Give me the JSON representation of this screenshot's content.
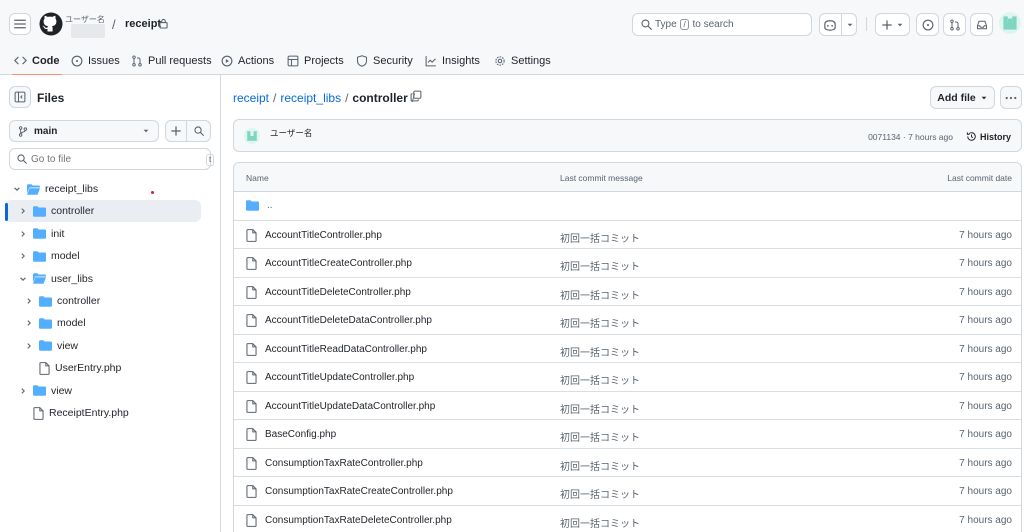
{
  "header": {
    "owner_label": "ユーザー名",
    "repo_name": "receipt",
    "search_prefix": "Type",
    "search_key": "/",
    "search_suffix": "to search"
  },
  "tabs": [
    {
      "label": "Code",
      "icon": "code-icon",
      "active": true
    },
    {
      "label": "Issues",
      "icon": "issue-icon"
    },
    {
      "label": "Pull requests",
      "icon": "pull-request-icon"
    },
    {
      "label": "Actions",
      "icon": "play-icon"
    },
    {
      "label": "Projects",
      "icon": "table-icon"
    },
    {
      "label": "Security",
      "icon": "shield-icon"
    },
    {
      "label": "Insights",
      "icon": "graph-icon"
    },
    {
      "label": "Settings",
      "icon": "gear-icon"
    }
  ],
  "sidebar": {
    "title": "Files",
    "branch": "main",
    "goto_placeholder": "Go to file",
    "goto_key": "t",
    "tree": [
      {
        "label": "receipt_libs",
        "type": "folder",
        "depth": 0,
        "expanded": true
      },
      {
        "label": "controller",
        "type": "folder",
        "depth": 1,
        "expanded": false,
        "selected": true
      },
      {
        "label": "init",
        "type": "folder",
        "depth": 1,
        "expanded": false
      },
      {
        "label": "model",
        "type": "folder",
        "depth": 1,
        "expanded": false
      },
      {
        "label": "user_libs",
        "type": "folder",
        "depth": 1,
        "expanded": true
      },
      {
        "label": "controller",
        "type": "folder",
        "depth": 2,
        "expanded": false
      },
      {
        "label": "model",
        "type": "folder",
        "depth": 2,
        "expanded": false
      },
      {
        "label": "view",
        "type": "folder",
        "depth": 2,
        "expanded": false
      },
      {
        "label": "UserEntry.php",
        "type": "file",
        "depth": 2
      },
      {
        "label": "view",
        "type": "folder",
        "depth": 1,
        "expanded": false
      },
      {
        "label": "ReceiptEntry.php",
        "type": "file",
        "depth": 1
      }
    ]
  },
  "main": {
    "breadcrumb": {
      "root": "receipt",
      "mid": "receipt_libs",
      "current": "controller"
    },
    "add_file_label": "Add file",
    "commit": {
      "user": "ユーザー名",
      "meta": "0071134 · 7 hours ago",
      "history_label": "History"
    },
    "columns": {
      "name": "Name",
      "message": "Last commit message",
      "date": "Last commit date"
    },
    "parent_dir": "..",
    "files": [
      {
        "name": "AccountTitleController.php",
        "message": "初回一括コミット",
        "date": "7 hours ago"
      },
      {
        "name": "AccountTitleCreateController.php",
        "message": "初回一括コミット",
        "date": "7 hours ago"
      },
      {
        "name": "AccountTitleDeleteController.php",
        "message": "初回一括コミット",
        "date": "7 hours ago"
      },
      {
        "name": "AccountTitleDeleteDataController.php",
        "message": "初回一括コミット",
        "date": "7 hours ago"
      },
      {
        "name": "AccountTitleReadDataController.php",
        "message": "初回一括コミット",
        "date": "7 hours ago"
      },
      {
        "name": "AccountTitleUpdateController.php",
        "message": "初回一括コミット",
        "date": "7 hours ago"
      },
      {
        "name": "AccountTitleUpdateDataController.php",
        "message": "初回一括コミット",
        "date": "7 hours ago"
      },
      {
        "name": "BaseConfig.php",
        "message": "初回一括コミット",
        "date": "7 hours ago"
      },
      {
        "name": "ConsumptionTaxRateController.php",
        "message": "初回一括コミット",
        "date": "7 hours ago"
      },
      {
        "name": "ConsumptionTaxRateCreateController.php",
        "message": "初回一括コミット",
        "date": "7 hours ago"
      },
      {
        "name": "ConsumptionTaxRateDeleteController.php",
        "message": "初回一括コミット",
        "date": "7 hours ago"
      }
    ]
  },
  "colors": {
    "accent": "#0969da",
    "folder": "#54aeff",
    "tab_underline": "#fd8c73",
    "border": "#d0d7de"
  }
}
